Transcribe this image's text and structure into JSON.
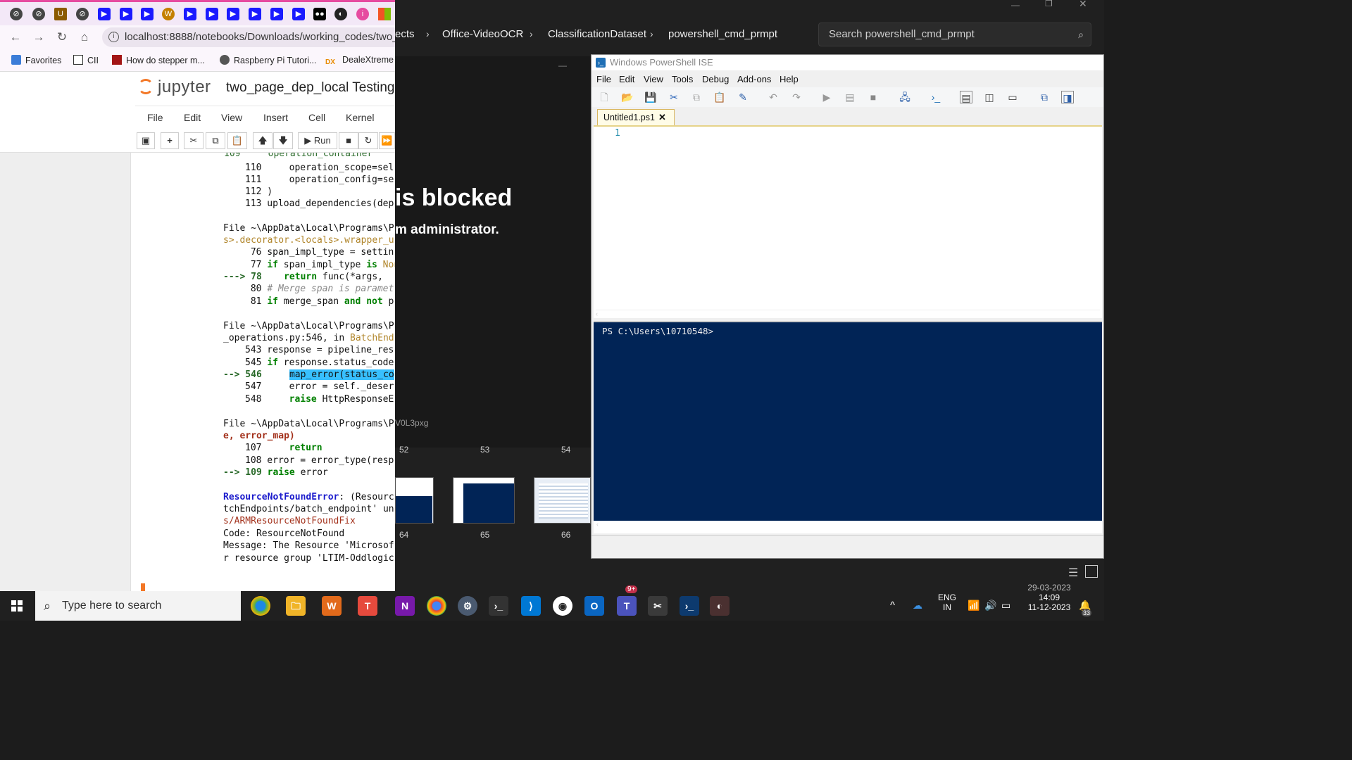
{
  "browser": {
    "url": "localhost:8888/notebooks/Downloads/working_codes/two_p",
    "favorites": [
      {
        "label": "Favorites"
      },
      {
        "label": "CII"
      },
      {
        "label": "How do stepper m..."
      },
      {
        "label": "Raspberry Pi Tutori..."
      },
      {
        "label": "DealeXtreme"
      }
    ]
  },
  "jupyter": {
    "logo_text": "jupyter",
    "notebook_title": "two_page_dep_local Testing",
    "menu": [
      "File",
      "Edit",
      "View",
      "Insert",
      "Cell",
      "Kernel"
    ],
    "run_label": "Run"
  },
  "code_lines": {
    "l109": "109     operation_container",
    "l110": "110     operation_scope=sel",
    "l111": "111     operation_config=se",
    "l112": "112 )",
    "l113": "113 upload_dependencies(dep",
    "f1": "File ~\\AppData\\Local\\Programs\\P",
    "f1b": "s>.decorator.<locals>.wrapper_u",
    "l76": " 76 span_impl_type = settin",
    "l77a": " 77 ",
    "l77kw": "if",
    "l77b": " span_impl_type ",
    "l77kw2": "is",
    "l77c": " Non",
    "l78a": "---> 78",
    "l78kw": "return",
    "l78b": " func(*args,",
    "l80a": " 80 ",
    "l80c": "# Merge span is paramet",
    "l81a": " 81 ",
    "l81kw": "if",
    "l81b": " merge_span ",
    "l81kw2": "and not",
    "l81c": " p",
    "f2": "File ~\\AppData\\Local\\Programs\\P",
    "f2b": "_operations.py:546, in ",
    "f2c": "BatchEnd",
    "l543": "543 response = pipeline_res",
    "l545a": "545 ",
    "l545kw": "if",
    "l545b": " response.status_code",
    "l546a": "--> 546",
    "l546hl": "map_error(status_co",
    "l547": "547     error = self._deser",
    "l548a": "548     ",
    "l548kw": "raise",
    "l548b": " HttpResponseE",
    "f3": "File ~\\AppData\\Local\\Programs\\P",
    "f3b": "e, error_map)",
    "l107a": "107     ",
    "l107kw": "return",
    "l108": "108 error = error_type(resp",
    "l109b_a": "--> 109",
    "l109b_kw": "raise",
    "l109b_b": " error",
    "err1a": "ResourceNotFoundError",
    "err1b": ": (Resourc",
    "err2": "tchEndpoints/batch_endpoint' un",
    "err3": "s/ARMResourceNotFoundFix",
    "err4": "Code: ResourceNotFound",
    "err5": "Message: The Resource 'Microsof",
    "err6": "r resource group 'LTIM-Oddlogic"
  },
  "explorer": {
    "breadcrumbs": [
      "ects",
      "Office-VideoOCR",
      "ClassificationDataset",
      "powershell_cmd_prmpt"
    ],
    "search_placeholder": "Search powershell_cmd_prmpt",
    "blocked_title": "is blocked",
    "blocked_sub": "m administrator.",
    "filename_fragment": "V0L3pxg",
    "thumb_numbers_top": [
      "52",
      "53",
      "54"
    ],
    "thumb_numbers_bottom": [
      "64",
      "65",
      "66"
    ]
  },
  "ise": {
    "title": "Windows PowerShell ISE",
    "menu": [
      "File",
      "Edit",
      "View",
      "Tools",
      "Debug",
      "Add-ons",
      "Help"
    ],
    "tab": "Untitled1.ps1",
    "line_number": "1",
    "prompt": "PS C:\\Users\\10710548>"
  },
  "taskbar": {
    "search_placeholder": "Type here to search",
    "lang1": "ENG",
    "lang2": "IN",
    "time": "14:09",
    "date": "11-12-2023",
    "date_behind": "29-03-2023",
    "teams_badge": "9+",
    "notif_count": "33"
  },
  "colors": {
    "tab_accent": "#e64ba0",
    "ps_console": "#012456",
    "jupyter_orange": "#f37726"
  }
}
